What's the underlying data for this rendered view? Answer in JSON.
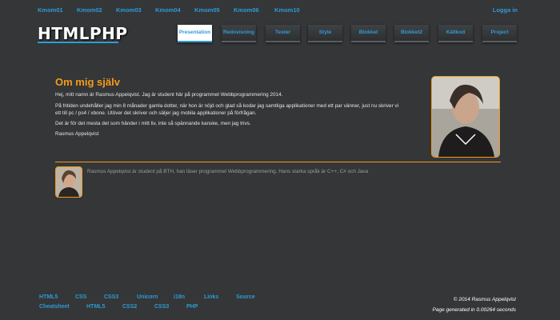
{
  "topnav": {
    "kmoms": [
      "Kmom01",
      "Kmom02",
      "Kmom03",
      "Kmom04",
      "Kmom05",
      "Kmom06",
      "Kmom10"
    ],
    "login": "Logga in"
  },
  "logo": "HTMLPHP",
  "tabs": [
    "Presentation",
    "Redovisning",
    "Tester",
    "Style",
    "Blokket",
    "Blokket2",
    "Källkod",
    "Project"
  ],
  "active_tab": "Presentation",
  "main": {
    "heading": "Om mig själv",
    "p1": "Hej, mitt namn är Rasmus Appelqvist. Jag är student här på programmet Webbprogrammering 2014.",
    "p2_line1": "På fritiden undehåller jag min 8 månader gamla dotter, när hon är nöjd och glad så kodar jag samtliga applikationer med ett par vänner, just nu skriver vi",
    "p2_line2": "ett till pc / ps4 / xbone. Utöver det skriver och säljer jag mobila applikationer på förfrågan.",
    "p3": "Det är för det mesta det som händer i mitt liv, inte så spännande kanske, men jag trivs.",
    "p4": "Rasmus Appelqvist"
  },
  "bio": "Rasmus Appelqvist är student på BTH, han läser programmet Webbprogrammering. Hans starka språk är C++, C# och Java",
  "footer": {
    "row1": [
      "HTML5",
      "CSS",
      "CSS3",
      "Unicorn",
      "i18n",
      "Links",
      "Source"
    ],
    "row2": [
      "Cheatsheet",
      "HTML5",
      "CSS2",
      "CSS3",
      "PHP"
    ],
    "copyright": "© 2014 Rasmus Appelqvist",
    "generated": "Page generated in 0.00264 seconds"
  },
  "colors": {
    "background": "#343638",
    "accent": "#f49b1a",
    "link": "#2f9bd6"
  }
}
